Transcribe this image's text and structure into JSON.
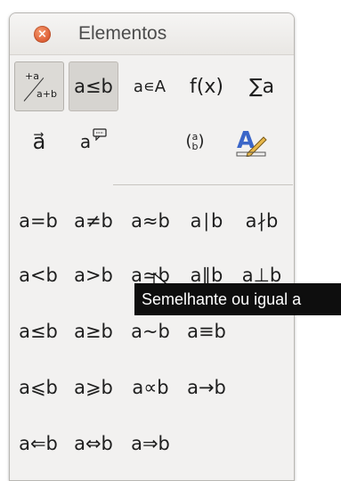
{
  "window": {
    "title": "Elementos",
    "close_glyph": "×"
  },
  "categories": [
    {
      "id": "unary",
      "label": "",
      "icon": "unary-binary-fraction-icon"
    },
    {
      "id": "relations",
      "label": "a≤b"
    },
    {
      "id": "set",
      "label": "a∊A"
    },
    {
      "id": "functions",
      "label": "f(x)"
    },
    {
      "id": "operators",
      "label": "∑a"
    },
    {
      "id": "attributes",
      "label": "a⃗"
    },
    {
      "id": "others",
      "label": "a"
    },
    {
      "id": "brackets",
      "label": "(a b)"
    },
    {
      "id": "formats",
      "label": "",
      "icon": "format-a-pencil-icon"
    }
  ],
  "symbols": [
    [
      "a=b",
      "a≠b",
      "a≈b",
      "a∣b",
      "a∤b"
    ],
    [
      "a<b",
      "a>b",
      "a≃b",
      "a∥b",
      "a⊥b"
    ],
    [
      "a≤b",
      "a≥b",
      "a~b",
      "a≡b"
    ],
    [
      "a⩽b",
      "a⩾b",
      "a∝b",
      "a→b"
    ],
    [
      "a⇐b",
      "a⇔b",
      "a⇒b"
    ]
  ],
  "unary_glyphs": {
    "top": "+a",
    "bottom": "a+b"
  },
  "binom_glyphs": {
    "top": "a",
    "bottom": "b"
  },
  "tooltip": "Semelhante ou igual a"
}
